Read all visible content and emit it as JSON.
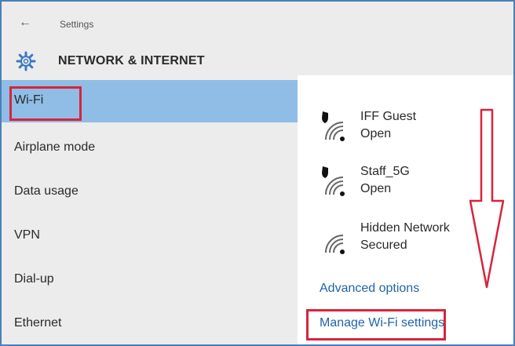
{
  "window": {
    "title": "Settings",
    "section_title": "NETWORK & INTERNET",
    "back_icon": "back-arrow-icon",
    "settings_icon": "gear-icon"
  },
  "sidebar": {
    "items": [
      {
        "label": "Wi-Fi",
        "selected": true
      },
      {
        "label": "Airplane mode"
      },
      {
        "label": "Data usage"
      },
      {
        "label": "VPN"
      },
      {
        "label": "Dial-up"
      },
      {
        "label": "Ethernet"
      }
    ]
  },
  "networks": [
    {
      "name": "IFF Guest",
      "status": "Open",
      "shield": true
    },
    {
      "name": "Staff_5G",
      "status": "Open",
      "shield": true
    },
    {
      "name": "Hidden Network",
      "status": "Secured",
      "shield": false
    }
  ],
  "links": {
    "advanced": "Advanced options",
    "manage": "Manage Wi-Fi settings"
  },
  "colors": {
    "accent": "#8fbde6",
    "highlight_border": "#d8243b",
    "link": "#1f64a8"
  }
}
